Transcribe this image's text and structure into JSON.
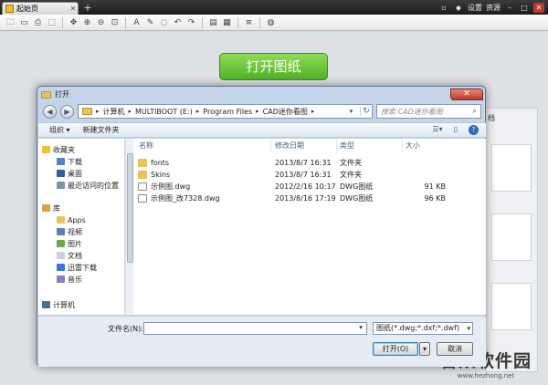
{
  "app": {
    "tab_label": "起始页",
    "tab_close": "✕",
    "new_tab": "+",
    "title_links": [
      "设置",
      "资源"
    ],
    "window_buttons": [
      "▫",
      "◆",
      "–",
      "□",
      "✕"
    ],
    "open_button": "打开图纸",
    "side_label": "档",
    "watermark": "合众软件园",
    "watermark_url": "www.hezhong.net"
  },
  "toolbar": {
    "icons": [
      "open-folder-icon",
      "save-icon",
      "print-icon",
      "zoom-window-icon",
      "pan-icon",
      "zoom-in-icon",
      "zoom-out-icon",
      "zoom-extents-icon",
      "text-icon",
      "pen-icon",
      "eraser-icon",
      "undo-icon",
      "redo-icon",
      "layer-icon",
      "layout-icon",
      "layers-stack-icon",
      "color-icon"
    ],
    "glyphs": [
      "🗀",
      "▭",
      "⎙",
      "⬚",
      "✥",
      "⊕",
      "⊖",
      "⊡",
      "A",
      "✎",
      "◌",
      "↶",
      "↷",
      "▤",
      "▦",
      "≡",
      "◍"
    ]
  },
  "dialog": {
    "title": "打开",
    "close": "✕",
    "back": "◀",
    "forward": "▶",
    "breadcrumbs": [
      "计算机",
      "MULTIBOOT (E:)",
      "Program Files",
      "CAD迷你看图"
    ],
    "search_placeholder": "搜索 CAD迷你看图",
    "organize": "组织 ▾",
    "new_folder": "新建文件夹",
    "nav_items": [
      {
        "label": "收藏夹",
        "icon": "star",
        "indent": 0
      },
      {
        "label": "下载",
        "icon": "download",
        "indent": 1
      },
      {
        "label": "桌面",
        "icon": "desktop",
        "indent": 1
      },
      {
        "label": "最近访问的位置",
        "icon": "recent",
        "indent": 1
      },
      {
        "label": "库",
        "icon": "library",
        "indent": 0
      },
      {
        "label": "Apps",
        "icon": "folder",
        "indent": 1
      },
      {
        "label": "视频",
        "icon": "video",
        "indent": 1
      },
      {
        "label": "图片",
        "icon": "picture",
        "indent": 1
      },
      {
        "label": "文档",
        "icon": "document",
        "indent": 1
      },
      {
        "label": "迅雷下载",
        "icon": "thunder",
        "indent": 1
      },
      {
        "label": "音乐",
        "icon": "music",
        "indent": 1
      },
      {
        "label": "计算机",
        "icon": "computer",
        "indent": 0
      }
    ],
    "columns": [
      "名称",
      "修改日期",
      "类型",
      "大小"
    ],
    "files": [
      {
        "name": "fonts",
        "date": "2013/8/7 16:31",
        "type": "文件夹",
        "size": "",
        "icon": "folder"
      },
      {
        "name": "Skins",
        "date": "2013/8/7 16:31",
        "type": "文件夹",
        "size": "",
        "icon": "folder"
      },
      {
        "name": "示例图.dwg",
        "date": "2012/2/16 10:17",
        "type": "DWG图纸",
        "size": "91 KB",
        "icon": "dwg"
      },
      {
        "name": "示例图_改7328.dwg",
        "date": "2013/8/16 17:19",
        "type": "DWG图纸",
        "size": "96 KB",
        "icon": "dwg"
      }
    ],
    "filename_label": "文件名(N):",
    "filename_value": "",
    "filetype": "图纸(*.dwg;*.dxf;*.dwf)",
    "open_button": "打开(O)",
    "cancel_button": "取消"
  }
}
